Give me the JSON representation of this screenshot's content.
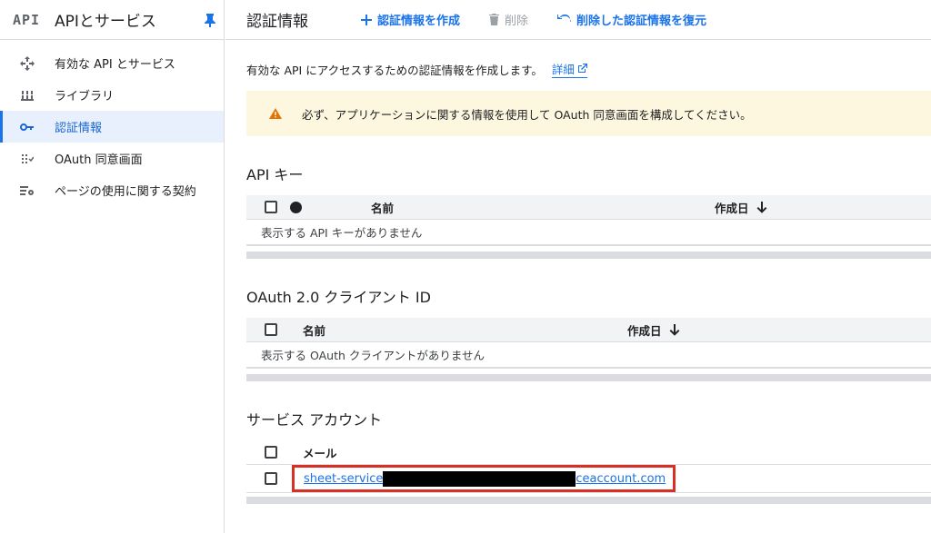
{
  "sidebar": {
    "logo": "API",
    "title": "APIとサービス",
    "items": [
      {
        "label": "有効な API とサービス"
      },
      {
        "label": "ライブラリ"
      },
      {
        "label": "認証情報"
      },
      {
        "label": "OAuth 同意画面"
      },
      {
        "label": "ページの使用に関する契約"
      }
    ]
  },
  "topbar": {
    "title": "認証情報",
    "create_label": "認証情報を作成",
    "delete_label": "削除",
    "restore_label": "削除した認証情報を復元"
  },
  "intro": {
    "text": "有効な API にアクセスするための認証情報を作成します。",
    "link_label": "詳細"
  },
  "warning": {
    "text": "必ず、アプリケーションに関する情報を使用して OAuth 同意画面を構成してください。"
  },
  "api_keys": {
    "title": "API キー",
    "columns": {
      "name": "名前",
      "created": "作成日"
    },
    "empty": "表示する API キーがありません"
  },
  "oauth": {
    "title": "OAuth 2.0 クライアント ID",
    "columns": {
      "name": "名前",
      "created": "作成日"
    },
    "empty": "表示する OAuth クライアントがありません"
  },
  "service_accounts": {
    "title": "サービス アカウント",
    "columns": {
      "email": "メール"
    },
    "rows": [
      {
        "email_prefix": "sheet-service",
        "email_suffix": "ceaccount.com"
      }
    ]
  },
  "colors": {
    "accent": "#1a73e8",
    "active_bg": "#e8f0fe",
    "warning_bg": "#fef7e0",
    "warning_icon": "#e37400",
    "highlight_box": "#d93025"
  }
}
